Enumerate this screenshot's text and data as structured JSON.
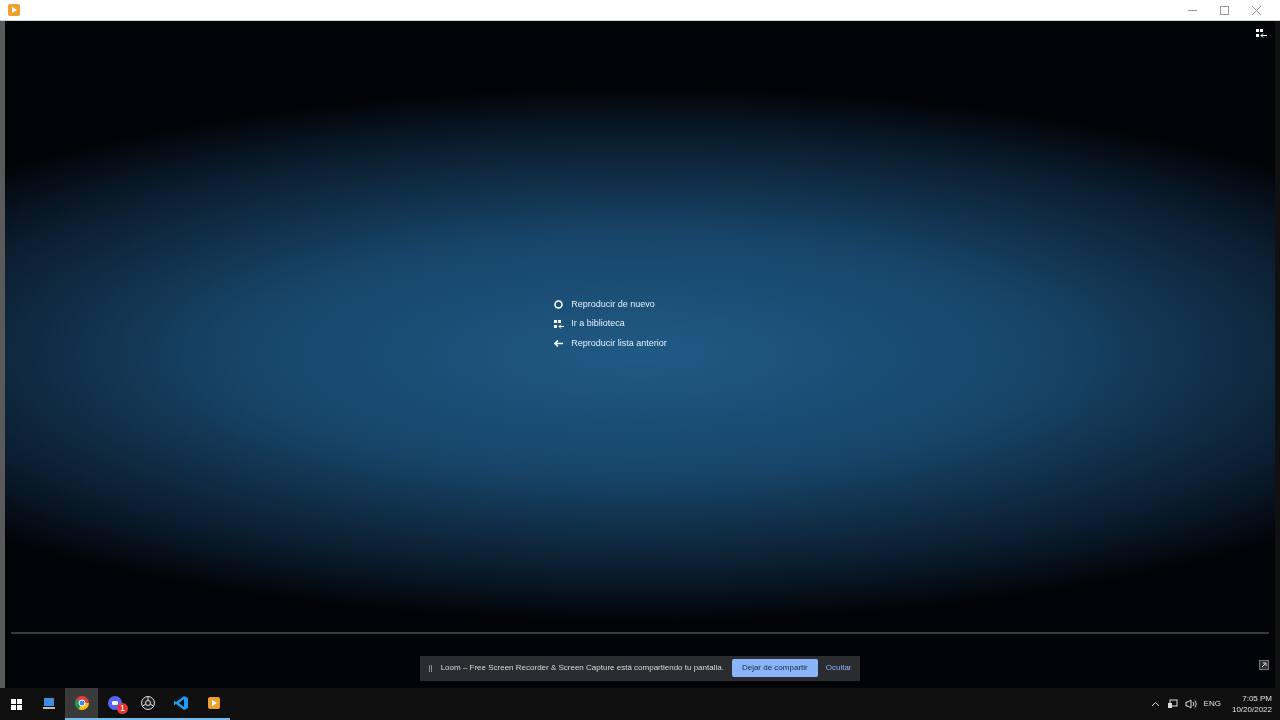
{
  "end_menu": [
    {
      "kind": "replay",
      "label": "Reproducir de nuevo"
    },
    {
      "kind": "library",
      "label": "Ir a biblioteca"
    },
    {
      "kind": "back",
      "label": "Reproducir lista anterior"
    }
  ],
  "share_bar": {
    "pause": "||",
    "message": "Loom – Free Screen Recorder & Screen Capture está compartiendo tu pantalla.",
    "stop_button": "Dejar de compartir",
    "hide_link": "Ocultar"
  },
  "taskbar": {
    "apps": [
      {
        "kind": "explorer",
        "selected": false,
        "running": false
      },
      {
        "kind": "chrome",
        "selected": true,
        "running": true
      },
      {
        "kind": "chat",
        "selected": false,
        "running": true,
        "badge": "1"
      },
      {
        "kind": "recorder",
        "selected": false,
        "running": true
      },
      {
        "kind": "code",
        "selected": false,
        "running": true
      },
      {
        "kind": "player",
        "selected": false,
        "running": true
      }
    ],
    "language": "ENG",
    "time": "7:05 PM",
    "date": "10/20/2022"
  }
}
